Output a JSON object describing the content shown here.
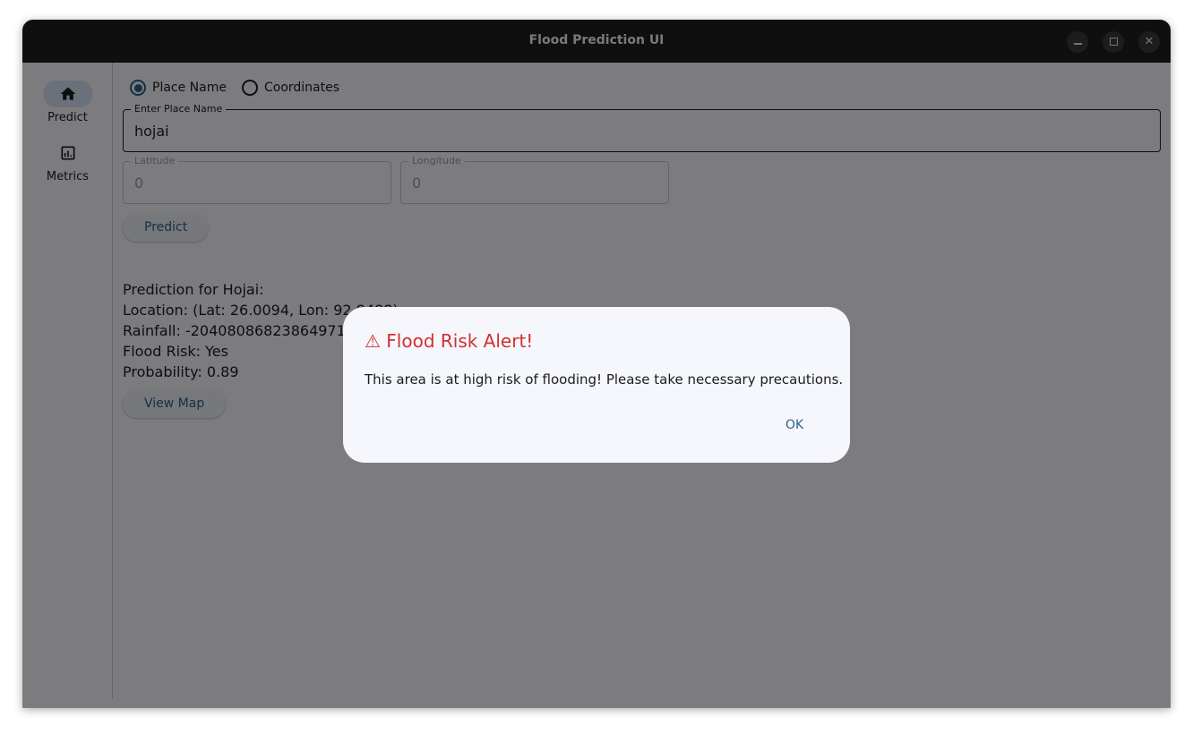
{
  "window": {
    "title": "Flood Prediction UI",
    "minimize_glyph": "",
    "close_glyph": "✕"
  },
  "rail": {
    "items": [
      {
        "label": "Predict",
        "icon": "home-icon",
        "selected": true
      },
      {
        "label": "Metrics",
        "icon": "bar-chart-icon",
        "selected": false
      }
    ]
  },
  "form": {
    "mode_options": [
      {
        "label": "Place Name",
        "selected": true
      },
      {
        "label": "Coordinates",
        "selected": false
      }
    ],
    "place": {
      "label": "Enter Place Name",
      "value": "hojai"
    },
    "latitude": {
      "label": "Latitude",
      "value": "0"
    },
    "longitude": {
      "label": "Longitude",
      "value": "0"
    },
    "predict_label": "Predict"
  },
  "results": {
    "heading": "Prediction for Hojai:",
    "location": "Location: (Lat: 26.0094, Lon: 92.8488)",
    "rainfall": "Rainfall: -2040808682386497133",
    "flood_risk": "Flood Risk: Yes",
    "probability": "Probability: 0.89",
    "view_map_label": "View Map"
  },
  "dialog": {
    "title": "⚠ Flood Risk Alert!",
    "body": "This area is at high risk of flooding! Please take necessary precautions.",
    "ok_label": "OK"
  },
  "colors": {
    "accent": "#2a5f8f",
    "alert": "#d32f2f",
    "titlebar": "#1f1f1f",
    "overlay": "rgba(0,0,0,0.5)"
  }
}
